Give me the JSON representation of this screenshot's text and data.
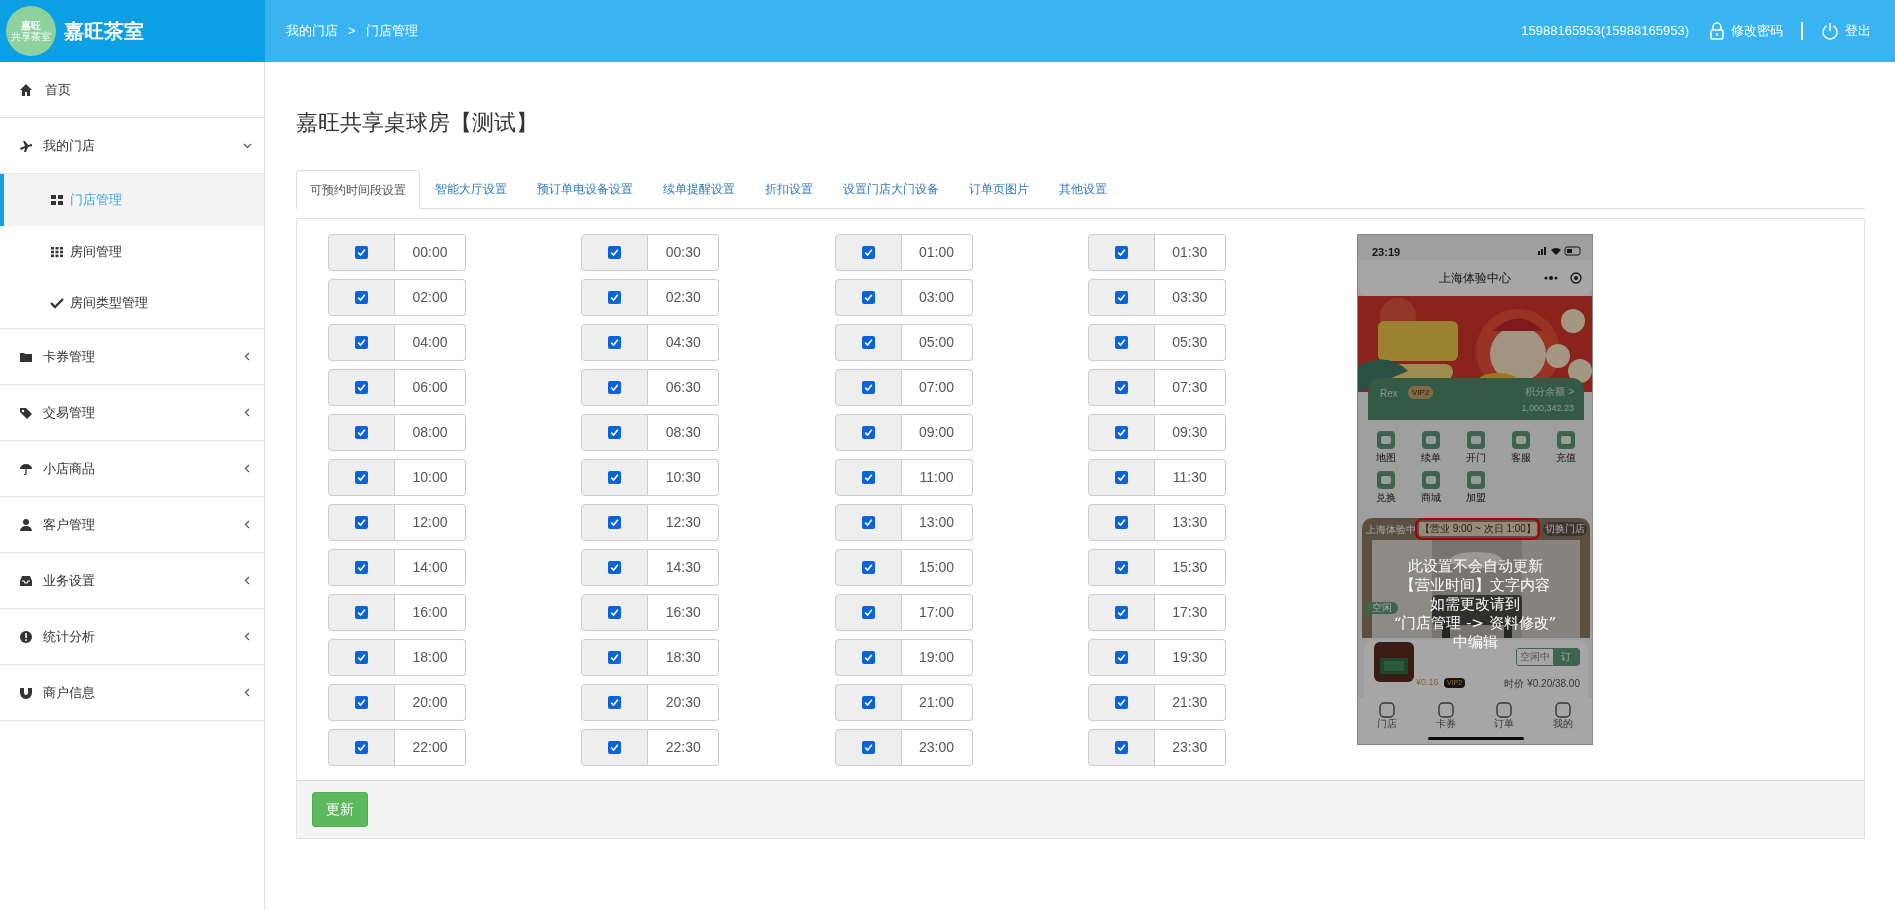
{
  "header": {
    "logo_text": [
      "嘉旺",
      "共享茶室"
    ],
    "brand": "嘉旺茶室",
    "breadcrumb": [
      "我的门店",
      "门店管理"
    ],
    "breadcrumb_sep": ">",
    "user": "15988165953(15988165953)",
    "change_password": "修改密码",
    "logout": "登出"
  },
  "sidebar": {
    "items": [
      {
        "label": "首页",
        "kind": "link"
      },
      {
        "label": "我的门店",
        "kind": "group",
        "expanded": true,
        "children": [
          {
            "label": "门店管理",
            "selected": true
          },
          {
            "label": "房间管理",
            "selected": false
          },
          {
            "label": "房间类型管理",
            "selected": false
          }
        ]
      },
      {
        "label": "卡券管理",
        "kind": "group",
        "expanded": false
      },
      {
        "label": "交易管理",
        "kind": "group",
        "expanded": false
      },
      {
        "label": "小店商品",
        "kind": "group",
        "expanded": false
      },
      {
        "label": "客户管理",
        "kind": "group",
        "expanded": false
      },
      {
        "label": "业务设置",
        "kind": "group",
        "expanded": false
      },
      {
        "label": "统计分析",
        "kind": "group",
        "expanded": false
      },
      {
        "label": "商户信息",
        "kind": "group",
        "expanded": false
      }
    ]
  },
  "page_title": "嘉旺共享桌球房【测试】",
  "tabs": [
    {
      "label": "可预约时间段设置",
      "selected": true
    },
    {
      "label": "智能大厅设置",
      "selected": false
    },
    {
      "label": "预订单电设备设置",
      "selected": false
    },
    {
      "label": "续单提醒设置",
      "selected": false
    },
    {
      "label": "折扣设置",
      "selected": false
    },
    {
      "label": "设置门店大门设备",
      "selected": false
    },
    {
      "label": "订单页图片",
      "selected": false
    },
    {
      "label": "其他设置",
      "selected": false
    }
  ],
  "slots": [
    {
      "time": "00:00",
      "checked": true
    },
    {
      "time": "00:30",
      "checked": true
    },
    {
      "time": "01:00",
      "checked": true
    },
    {
      "time": "01:30",
      "checked": true
    },
    {
      "time": "02:00",
      "checked": true
    },
    {
      "time": "02:30",
      "checked": true
    },
    {
      "time": "03:00",
      "checked": true
    },
    {
      "time": "03:30",
      "checked": true
    },
    {
      "time": "04:00",
      "checked": true
    },
    {
      "time": "04:30",
      "checked": true
    },
    {
      "time": "05:00",
      "checked": true
    },
    {
      "time": "05:30",
      "checked": true
    },
    {
      "time": "06:00",
      "checked": true
    },
    {
      "time": "06:30",
      "checked": true
    },
    {
      "time": "07:00",
      "checked": true
    },
    {
      "time": "07:30",
      "checked": true
    },
    {
      "time": "08:00",
      "checked": true
    },
    {
      "time": "08:30",
      "checked": true
    },
    {
      "time": "09:00",
      "checked": true
    },
    {
      "time": "09:30",
      "checked": true
    },
    {
      "time": "10:00",
      "checked": true
    },
    {
      "time": "10:30",
      "checked": true
    },
    {
      "time": "11:00",
      "checked": true
    },
    {
      "time": "11:30",
      "checked": true
    },
    {
      "time": "12:00",
      "checked": true
    },
    {
      "time": "12:30",
      "checked": true
    },
    {
      "time": "13:00",
      "checked": true
    },
    {
      "time": "13:30",
      "checked": true
    },
    {
      "time": "14:00",
      "checked": true
    },
    {
      "time": "14:30",
      "checked": true
    },
    {
      "time": "15:00",
      "checked": true
    },
    {
      "time": "15:30",
      "checked": true
    },
    {
      "time": "16:00",
      "checked": true
    },
    {
      "time": "16:30",
      "checked": true
    },
    {
      "time": "17:00",
      "checked": true
    },
    {
      "time": "17:30",
      "checked": true
    },
    {
      "time": "18:00",
      "checked": true
    },
    {
      "time": "18:30",
      "checked": true
    },
    {
      "time": "19:00",
      "checked": true
    },
    {
      "time": "19:30",
      "checked": true
    },
    {
      "time": "20:00",
      "checked": true
    },
    {
      "time": "20:30",
      "checked": true
    },
    {
      "time": "21:00",
      "checked": true
    },
    {
      "time": "21:30",
      "checked": true
    },
    {
      "time": "22:00",
      "checked": true
    },
    {
      "time": "22:30",
      "checked": true
    },
    {
      "time": "23:00",
      "checked": true
    },
    {
      "time": "23:30",
      "checked": true
    }
  ],
  "preview": {
    "status_time": "23:19",
    "title": "上海体验中心",
    "member_name": "Rex",
    "member_badge": "VIP2",
    "points_label": "积分余额 >",
    "points": "1,000,342.23",
    "shortcuts": [
      "地图",
      "续单",
      "开门",
      "客服",
      "充值",
      "兑换",
      "商城",
      "加盟"
    ],
    "store_name": "上海体验中",
    "hours": "【营业 9:00 ~ 次日 1:00】",
    "switch_store": "切换门店",
    "room_status": "空闲",
    "room_state": "空闲中",
    "book": "订",
    "price": "¥0.16",
    "price_badge": "VIP2",
    "list_price": "时价 ¥0.20/38.00",
    "nav": [
      "门店",
      "卡券",
      "订单",
      "我的"
    ],
    "notice_lines": [
      "此设置不会自动更新",
      "【营业时间】文字内容",
      "如需更改请到",
      "“门店管理 -> 资料修改”",
      "中编辑"
    ]
  },
  "update_button": "更新"
}
